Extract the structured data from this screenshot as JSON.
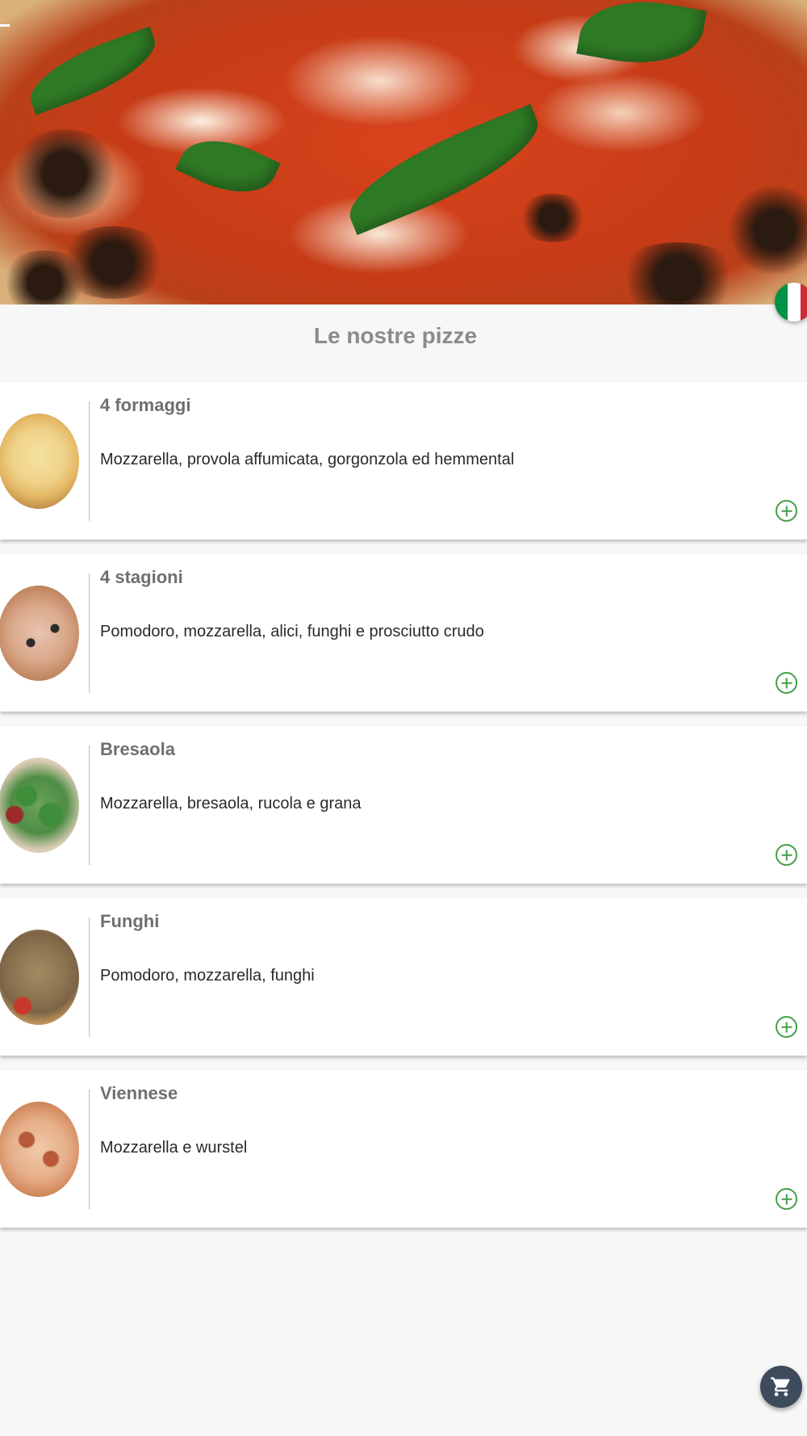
{
  "header": {
    "hero_image": "margherita-pizza-photo",
    "back_icon": "back-arrow-icon",
    "language_flag": {
      "icon": "italian-flag-icon",
      "colors": [
        "#009246",
        "#ffffff",
        "#ce2b37"
      ]
    }
  },
  "section_title": "Le nostre pizze",
  "menu_items": [
    {
      "name": "4 formaggi",
      "description": "Mozzarella, provola affumicata, gorgonzola ed hemmental",
      "thumb": "quattro-formaggi-image"
    },
    {
      "name": "4 stagioni",
      "description": "Pomodoro, mozzarella, alici, funghi e prosciutto crudo",
      "thumb": "quattro-stagioni-image"
    },
    {
      "name": "Bresaola",
      "description": "Mozzarella, bresaola, rucola e grana",
      "thumb": "bresaola-image"
    },
    {
      "name": "Funghi",
      "description": "Pomodoro, mozzarella, funghi",
      "thumb": "funghi-image"
    },
    {
      "name": "Viennese",
      "description": "Mozzarella e wurstel",
      "thumb": "viennese-image"
    }
  ],
  "add_icon": "add-circle-icon",
  "cart": {
    "icon": "shopping-cart-icon",
    "color": "#3d4b5c"
  },
  "accent_color": "#43a047"
}
